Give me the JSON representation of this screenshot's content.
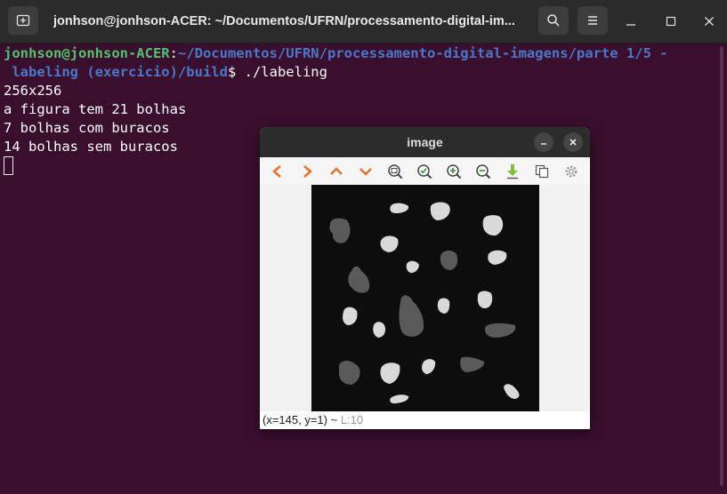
{
  "terminal": {
    "title": "jonhson@jonhson-ACER: ~/Documentos/UFRN/processamento-digital-im...",
    "prompt_user": "jonhson@jonhson-ACER",
    "prompt_sep": ":",
    "prompt_path_1": "~/Documentos/UFRN/processamento-digital-imagens/parte 1/5 -",
    "prompt_path_2": " labeling (exercicio)/build",
    "prompt_symbol": "$ ",
    "command": "./labeling",
    "output": [
      "256x256",
      "a figura tem 21 bolhas",
      "7 bolhas com buracos",
      "14 bolhas sem buracos"
    ],
    "icons": {
      "new_tab": "new-tab-icon",
      "search": "search-icon",
      "menu": "hamburger-menu-icon",
      "minimize": "minimize-icon",
      "maximize": "maximize-icon",
      "close": "close-icon"
    }
  },
  "image_window": {
    "title": "image",
    "toolbar": [
      "pan-left-icon",
      "pan-right-icon",
      "pan-up-icon",
      "pan-down-icon",
      "zoom-fit-icon",
      "zoom-100-icon",
      "zoom-in-icon",
      "zoom-out-icon",
      "save-icon",
      "copy-icon",
      "properties-icon"
    ],
    "status_coords": "(x=145, y=1) ~ ",
    "status_level": "L:10",
    "image_size": "256x256"
  },
  "colors": {
    "terminal_bg": "#3a0f2e",
    "user_green": "#4fc26b",
    "path_blue": "#4a78c8",
    "blob_light": "#d9d9d9",
    "blob_dark": "#5a5a5a",
    "image_bg": "#0d0d0d"
  }
}
